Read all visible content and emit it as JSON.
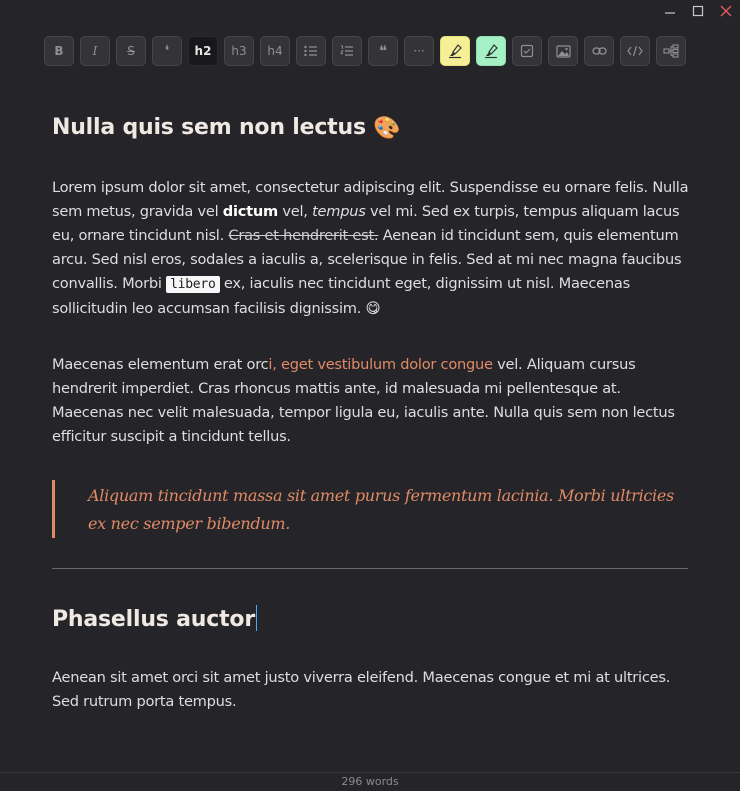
{
  "window": {
    "controls": [
      "minimize",
      "maximize",
      "close"
    ]
  },
  "toolbar": {
    "buttons": [
      {
        "id": "bold",
        "label": "B"
      },
      {
        "id": "italic",
        "label": "I"
      },
      {
        "id": "strike",
        "label": "S"
      },
      {
        "id": "quote-mark",
        "label": "❛"
      },
      {
        "id": "h2",
        "label": "h2",
        "active": true
      },
      {
        "id": "h3",
        "label": "h3"
      },
      {
        "id": "h4",
        "label": "h4"
      },
      {
        "id": "bullet-list",
        "icon": "bullet-list-icon"
      },
      {
        "id": "ordered-list",
        "icon": "ordered-list-icon"
      },
      {
        "id": "blockquote",
        "label": "❝"
      },
      {
        "id": "horizontal-rule",
        "label": "···"
      },
      {
        "id": "highlight-yellow",
        "icon": "highlighter-icon",
        "color": "#f7ef95"
      },
      {
        "id": "highlight-green",
        "icon": "highlighter-icon",
        "color": "#a5f0c5"
      },
      {
        "id": "checkbox",
        "icon": "checkbox-icon"
      },
      {
        "id": "image",
        "icon": "image-icon"
      },
      {
        "id": "link",
        "icon": "link-icon"
      },
      {
        "id": "code",
        "icon": "code-icon"
      },
      {
        "id": "outline",
        "icon": "outline-icon"
      }
    ]
  },
  "doc": {
    "h1": "Nulla quis sem non lectus",
    "h1_emoji": "🎨",
    "p1": {
      "a": "Lorem ipsum dolor sit amet, consectetur adipiscing elit. Suspendisse eu ornare felis. Nulla sem metus, gravida vel ",
      "bold": "dictum",
      "b": " vel, ",
      "italic": "tempus",
      "c": " vel mi. Sed ex turpis, tempus aliquam lacus eu, ornare tincidunt nisl. ",
      "strike": "Cras et hendrerit est.",
      "d": " Aenean id tincidunt sem, quis elementum arcu. Sed nisl eros, sodales a iaculis a, scelerisque in felis. Sed at mi nec magna faucibus convallis. Morbi ",
      "code": "libero",
      "e": " ex, iaculis nec tincidunt eget, dignissim ut nisl. Maecenas sollicitudin leo accumsan facilisis dignissim. ",
      "emoji": "😋"
    },
    "p2": {
      "a": "Maecenas elementum erat orc",
      "link": "i, eget vestibulum dolor congue",
      "b": " vel. Aliquam cursus hendrerit imperdiet. Cras rhoncus mattis ante, id malesuada mi pellentesque at. Maecenas nec velit malesuada, tempor ligula eu, iaculis ante. Nulla quis sem non lectus efficitur suscipit a tincidunt tellus."
    },
    "blockquote": "Aliquam tincidunt massa sit amet purus fermentum lacinia. Morbi ultricies ex nec semper bibendum.",
    "h2": "Phasellus auctor",
    "p3": "Aenean sit amet orci sit amet justo viverra eleifend. Maecenas congue et mi at ultrices. Sed rutrum porta tempus."
  },
  "status": {
    "word_count": "296 words"
  },
  "colors": {
    "accent": "#e08a66",
    "background": "#252529",
    "caret": "#4aa8ff"
  }
}
